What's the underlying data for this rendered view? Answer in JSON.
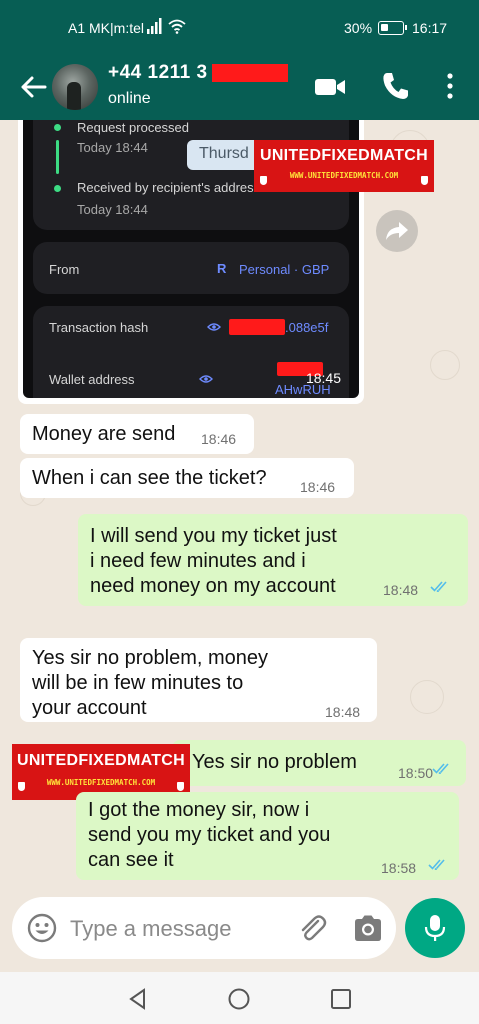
{
  "status_bar": {
    "carrier": "A1 MK|m:tel",
    "battery": "30%",
    "time": "16:17",
    "icons": [
      "signal-icon",
      "wifi-icon",
      "battery-icon"
    ]
  },
  "header": {
    "contact_name": "+44 1211 3",
    "presence": "online",
    "icons": [
      "back-arrow-icon",
      "avatar",
      "video-call-icon",
      "phone-call-icon",
      "more-vert-icon"
    ]
  },
  "image_message": {
    "steps": [
      {
        "title": "Request processed",
        "time": "Today 18:44"
      },
      {
        "title": "Received by recipient's address",
        "time": "Today 18:44"
      }
    ],
    "chip_text": "Thursd",
    "from_label": "From",
    "from_value": "Personal · GBP",
    "tx_hash_label": "Transaction hash",
    "tx_hash_value": ".088e5f",
    "wallet_label": "Wallet address",
    "wallet_value": "AHwRUH",
    "time": "18:45"
  },
  "watermark": {
    "brand": "UNITEDFIXEDMATCH",
    "url": "WWW.UNITEDFIXEDMATCH.COM"
  },
  "messages": [
    {
      "dir": "in",
      "text": "Money are send",
      "time": "18:46"
    },
    {
      "dir": "in",
      "text": "When i can see the ticket?",
      "time": "18:46"
    },
    {
      "dir": "out",
      "lines": [
        "I will send you my ticket just",
        "i need few minutes and i",
        "need money on my account"
      ],
      "time": "18:48",
      "read": true
    },
    {
      "dir": "in",
      "lines": [
        "Yes sir no problem, money",
        "will be in few minutes to",
        "your account"
      ],
      "time": "18:48"
    },
    {
      "dir": "out",
      "text": "Yes sir no problem",
      "time": "18:50",
      "read": true
    },
    {
      "dir": "out",
      "lines": [
        "I got the money sir, now i",
        "send you my ticket and you",
        "can see it"
      ],
      "time": "18:58",
      "read": true
    }
  ],
  "composer": {
    "placeholder": "Type a message",
    "icons": [
      "emoji-icon",
      "attach-icon",
      "camera-icon",
      "mic-icon"
    ]
  },
  "nav_bar": {
    "icons": [
      "back-triangle-icon",
      "home-circle-icon",
      "recents-square-icon"
    ]
  },
  "colors": {
    "header": "#075e54",
    "outgoing_bubble": "#dcf8c6",
    "incoming_bubble": "#ffffff",
    "chat_bg": "#efe7dd",
    "read_ticks": "#53bdeb",
    "mic_button": "#00a884",
    "redaction": "#ff1a1a",
    "watermark_bg": "#d81414"
  }
}
